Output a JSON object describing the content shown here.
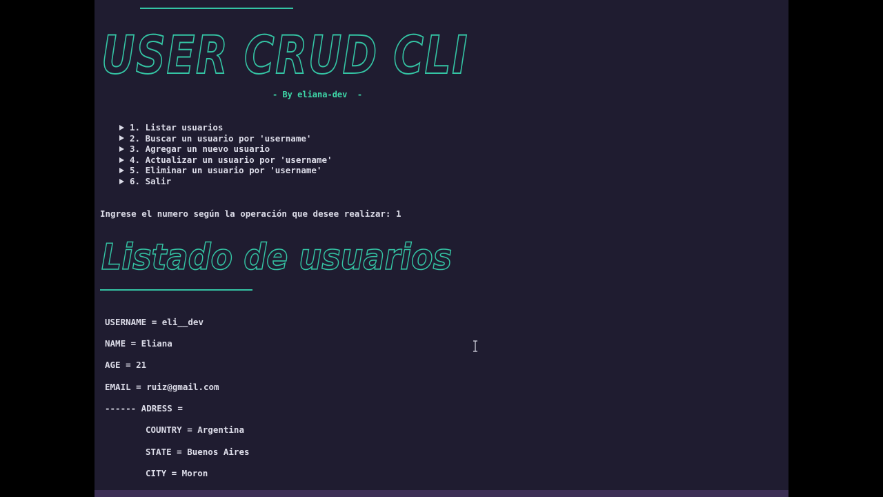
{
  "banner_title": "USER CRUD CLI",
  "byline": "- By eliana-dev  -",
  "menu": [
    {
      "label": "1. Listar usuarios"
    },
    {
      "label": "2. Buscar un usuario por 'username'"
    },
    {
      "label": "3. Agregar un nuevo usuario"
    },
    {
      "label": "4. Actualizar un usuario por 'username'"
    },
    {
      "label": "5. Eliminar un usuario por 'username'"
    },
    {
      "label": "6. Salir"
    }
  ],
  "prompt": "Ingrese el numero según la operación que desee realizar: 1",
  "section_title": "Listado de usuarios",
  "user": {
    "username": "USERNAME = eli__dev",
    "name": "NAME = Eliana",
    "age": "AGE = 21",
    "email": "EMAIL = ruiz@gmail.com",
    "address_header": "------ ADRESS =",
    "country": "COUNTRY = Argentina",
    "state": "STATE = Buenos Aires",
    "city": "CITY = Moron"
  },
  "colors": {
    "background": "#1f1c30",
    "accent": "#34c4a4",
    "text": "#dcdce8"
  },
  "icons": {
    "menu_bullet": "triangle-right-icon",
    "cursor": "text-cursor-icon"
  }
}
